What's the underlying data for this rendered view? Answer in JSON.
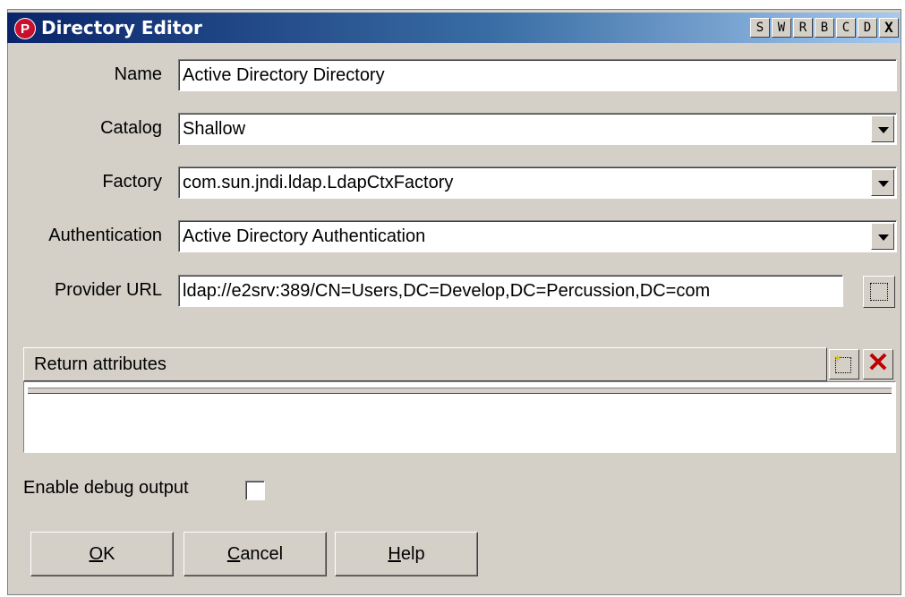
{
  "window": {
    "title": "Directory Editor",
    "titlebar_buttons": [
      "S",
      "W",
      "R",
      "B",
      "C",
      "D",
      "X"
    ]
  },
  "form": {
    "name_label": "Name",
    "name_value": "Active Directory Directory",
    "catalog_label": "Catalog",
    "catalog_value": "Shallow",
    "factory_label": "Factory",
    "factory_value": "com.sun.jndi.ldap.LdapCtxFactory",
    "authentication_label": "Authentication",
    "authentication_value": "Active Directory Authentication",
    "provider_url_label": "Provider URL",
    "provider_url_value": "ldap://e2srv:389/CN=Users,DC=Develop,DC=Percussion,DC=com"
  },
  "attributes_table": {
    "header": "Return attributes",
    "rows": []
  },
  "debug": {
    "label": "Enable debug output",
    "checked": false
  },
  "buttons": {
    "ok_mnemonic": "O",
    "ok_rest": "K",
    "cancel_mnemonic": "C",
    "cancel_rest": "ancel",
    "help_mnemonic": "H",
    "help_rest": "elp"
  },
  "icons": {
    "app": "percussion-logo-icon",
    "browse": "browse-icon",
    "add_row": "new-row-icon",
    "delete_row": "delete-x-icon"
  },
  "colors": {
    "titlebar_start": "#0a246a",
    "titlebar_end": "#a6caf0",
    "dialog_bg": "#d4d0c8",
    "delete_red": "#c00000"
  }
}
